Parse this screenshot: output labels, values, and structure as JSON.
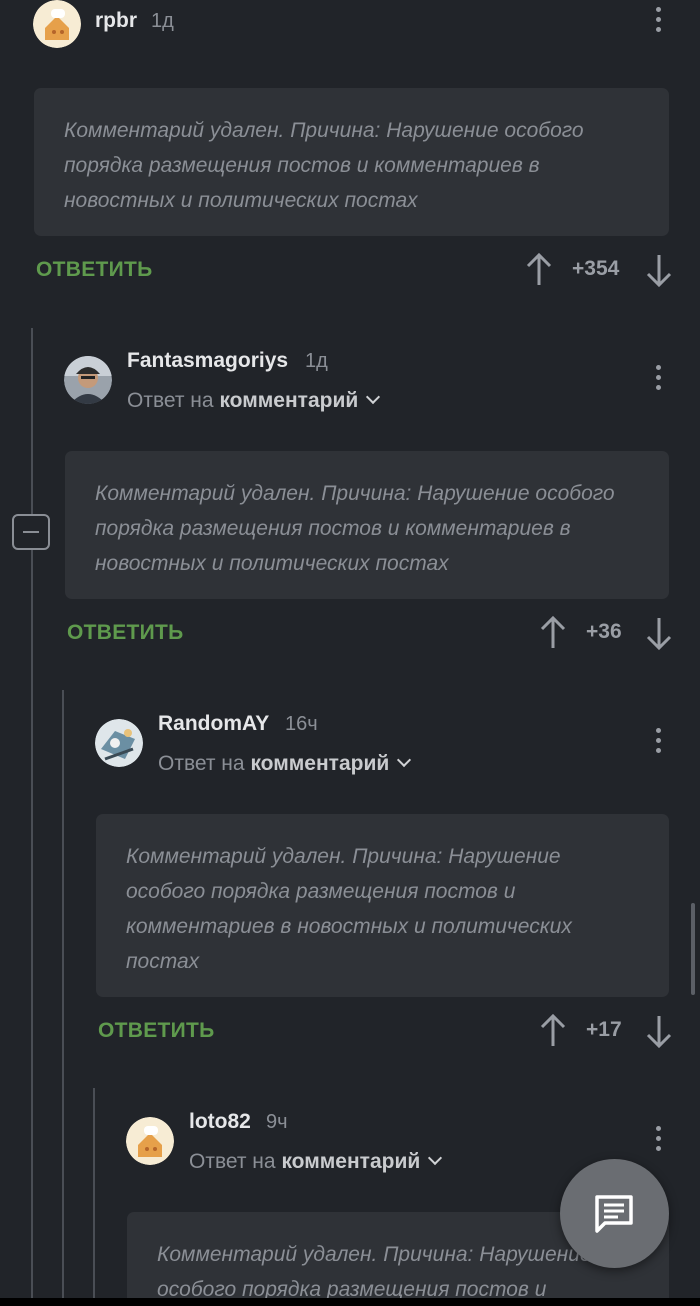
{
  "comments": [
    {
      "author": "rpbr",
      "time": "1д",
      "reply_prefix": "",
      "reply_target": "",
      "body": "Комментарий удален. Причина: Нарушение особого порядка размещения постов и комментариев в новостных и политических постах",
      "reply_label": "ОТВЕТИТЬ",
      "score": "+354"
    },
    {
      "author": "Fantasmagoriys",
      "time": "1д",
      "reply_prefix": "Ответ на",
      "reply_target": "комментарий",
      "body": "Комментарий удален. Причина: Нарушение особого порядка размещения постов и комментариев в новостных и политических постах",
      "reply_label": "ОТВЕТИТЬ",
      "score": "+36"
    },
    {
      "author": "RandomAY",
      "time": "16ч",
      "reply_prefix": "Ответ на",
      "reply_target": "комментарий",
      "body": "Комментарий удален. Причина: Нарушение особого порядка размещения постов и комментариев в новостных и политических постах",
      "reply_label": "ОТВЕТИТЬ",
      "score": "+17"
    },
    {
      "author": "loto82",
      "time": "9ч",
      "reply_prefix": "Ответ на",
      "reply_target": "комментарий",
      "body": "Комментарий удален. Причина: Нарушение особого порядка размещения постов и",
      "reply_label": "",
      "score": ""
    }
  ],
  "icons": {
    "upvote": "arrow-up-icon",
    "downvote": "arrow-down-icon",
    "more": "kebab-menu-icon",
    "collapse": "minus-icon",
    "fab": "comment-icon"
  },
  "colors": {
    "background": "#212429",
    "card": "#2f3237",
    "reply_green": "#5f9a4d",
    "muted_text": "#8b8f96"
  }
}
